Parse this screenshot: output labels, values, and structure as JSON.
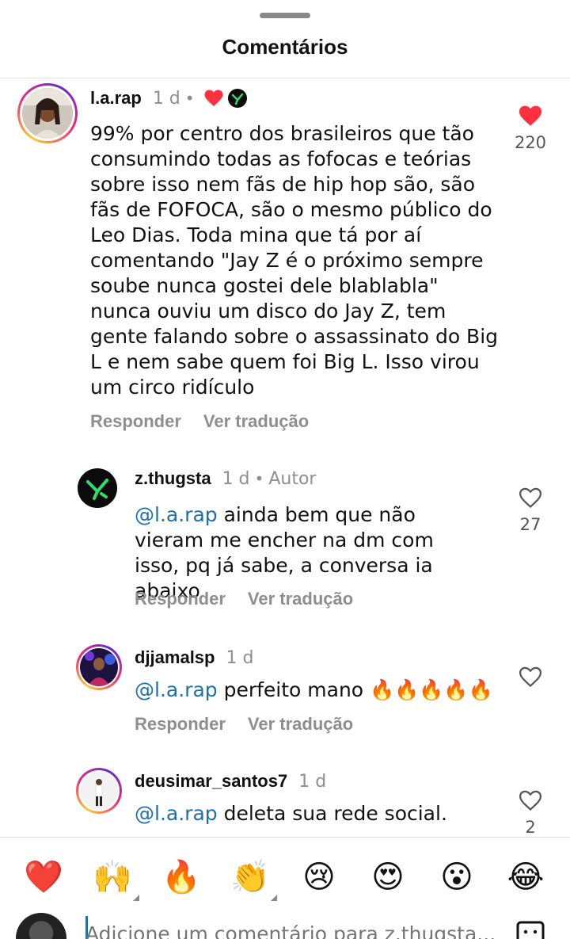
{
  "sheet": {
    "title": "Comentários"
  },
  "comments": [
    {
      "username": "l.a.rap",
      "time": "1 d",
      "text": "99% por centro dos brasileiros que tão consumindo todas as fofocas e teórias sobre isso nem fãs de hip hop são, são fãs de FOFOCA, são o mesmo público do Leo Dias. Toda mina que tá por aí comentando \"Jay Z é o próximo sempre soube nunca gostei dele blablabla\" nunca ouviu um disco do Jay Z, tem gente falando sobre o assassinato do Big L e nem sabe quem foi Big L. Isso virou um circo ridículo",
      "likes": "220",
      "liked": true,
      "reply_label": "Responder",
      "translate_label": "Ver tradução"
    },
    {
      "username": "z.thugsta",
      "time": "1 d",
      "author_tag": "Autor",
      "mention": "@l.a.rap",
      "text": " ainda bem que não vieram me encher na dm com isso, pq já sabe, a conversa ia abaixo",
      "likes": "27",
      "liked": false,
      "reply_label": "Responder",
      "translate_label": "Ver tradução"
    },
    {
      "username": "djjamalsp",
      "time": "1 d",
      "mention": "@l.a.rap",
      "text": " perfeito mano 🔥🔥🔥🔥🔥",
      "liked": false,
      "reply_label": "Responder",
      "translate_label": "Ver tradução"
    },
    {
      "username": "deusimar_santos7",
      "time": "1 d",
      "mention": "@l.a.rap",
      "text": " deleta sua rede social.",
      "likes": "2",
      "liked": false
    }
  ],
  "reactions": [
    "❤️",
    "🙌",
    "🔥",
    "👏",
    "😢",
    "😍",
    "😮",
    "😂"
  ],
  "input": {
    "placeholder": "Adicione um comentário para z.thugsta..."
  },
  "colors": {
    "like_red": "#ff3040",
    "mention_blue": "#1f6fa8",
    "secondary_gray": "#8e8e8e"
  }
}
